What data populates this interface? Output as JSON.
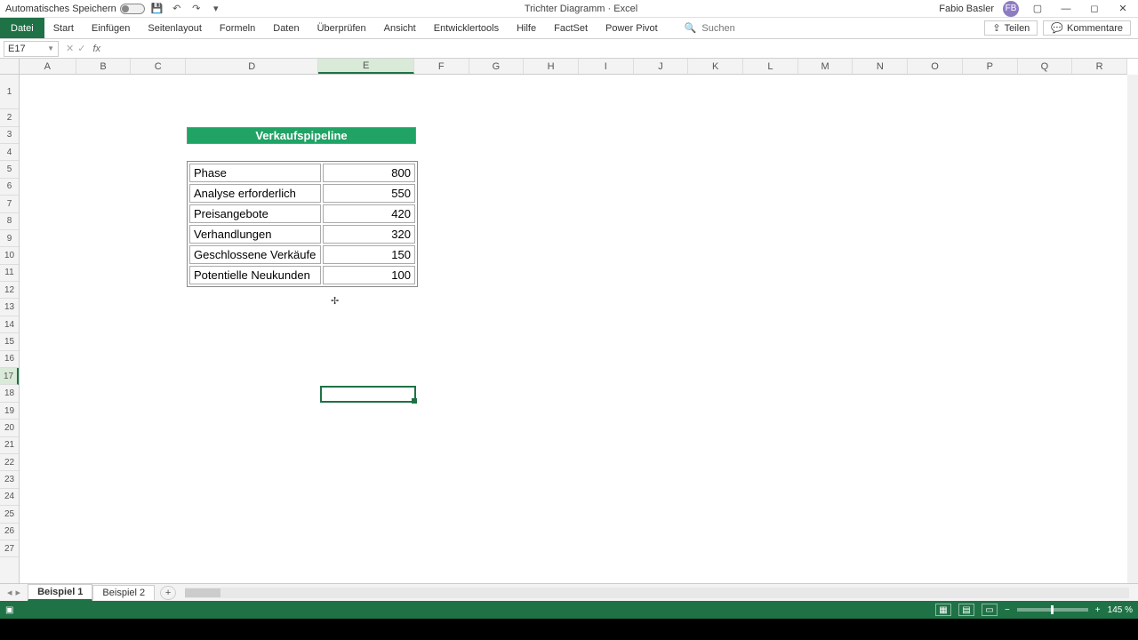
{
  "titlebar": {
    "autosave_label": "Automatisches Speichern",
    "doc_title": "Trichter Diagramm  ·  Excel",
    "user_name": "Fabio Basler",
    "user_initials": "FB"
  },
  "ribbon": {
    "file": "Datei",
    "tabs": [
      "Start",
      "Einfügen",
      "Seitenlayout",
      "Formeln",
      "Daten",
      "Überprüfen",
      "Ansicht",
      "Entwicklertools",
      "Hilfe",
      "FactSet",
      "Power Pivot"
    ],
    "search_placeholder": "Suchen",
    "share": "Teilen",
    "comments": "Kommentare"
  },
  "formulabar": {
    "cell_ref": "E17"
  },
  "columns": [
    "A",
    "B",
    "C",
    "D",
    "E",
    "F",
    "G",
    "H",
    "I",
    "J",
    "K",
    "L",
    "M",
    "N",
    "O",
    "P",
    "Q",
    "R"
  ],
  "rows_count": 27,
  "active_col": "E",
  "active_row": 17,
  "sheet": {
    "tabs": [
      "Beispiel 1",
      "Beispiel 2"
    ],
    "active": 0
  },
  "status": {
    "zoom": "145 %"
  },
  "content": {
    "header": "Verkaufspipeline",
    "rows": [
      {
        "label": "Phase",
        "value": "800"
      },
      {
        "label": "Analyse erforderlich",
        "value": "550"
      },
      {
        "label": "Preisangebote",
        "value": "420"
      },
      {
        "label": "Verhandlungen",
        "value": "320"
      },
      {
        "label": "Geschlossene Verkäufe",
        "value": "150"
      },
      {
        "label": "Potentielle Neukunden",
        "value": "100"
      }
    ]
  }
}
